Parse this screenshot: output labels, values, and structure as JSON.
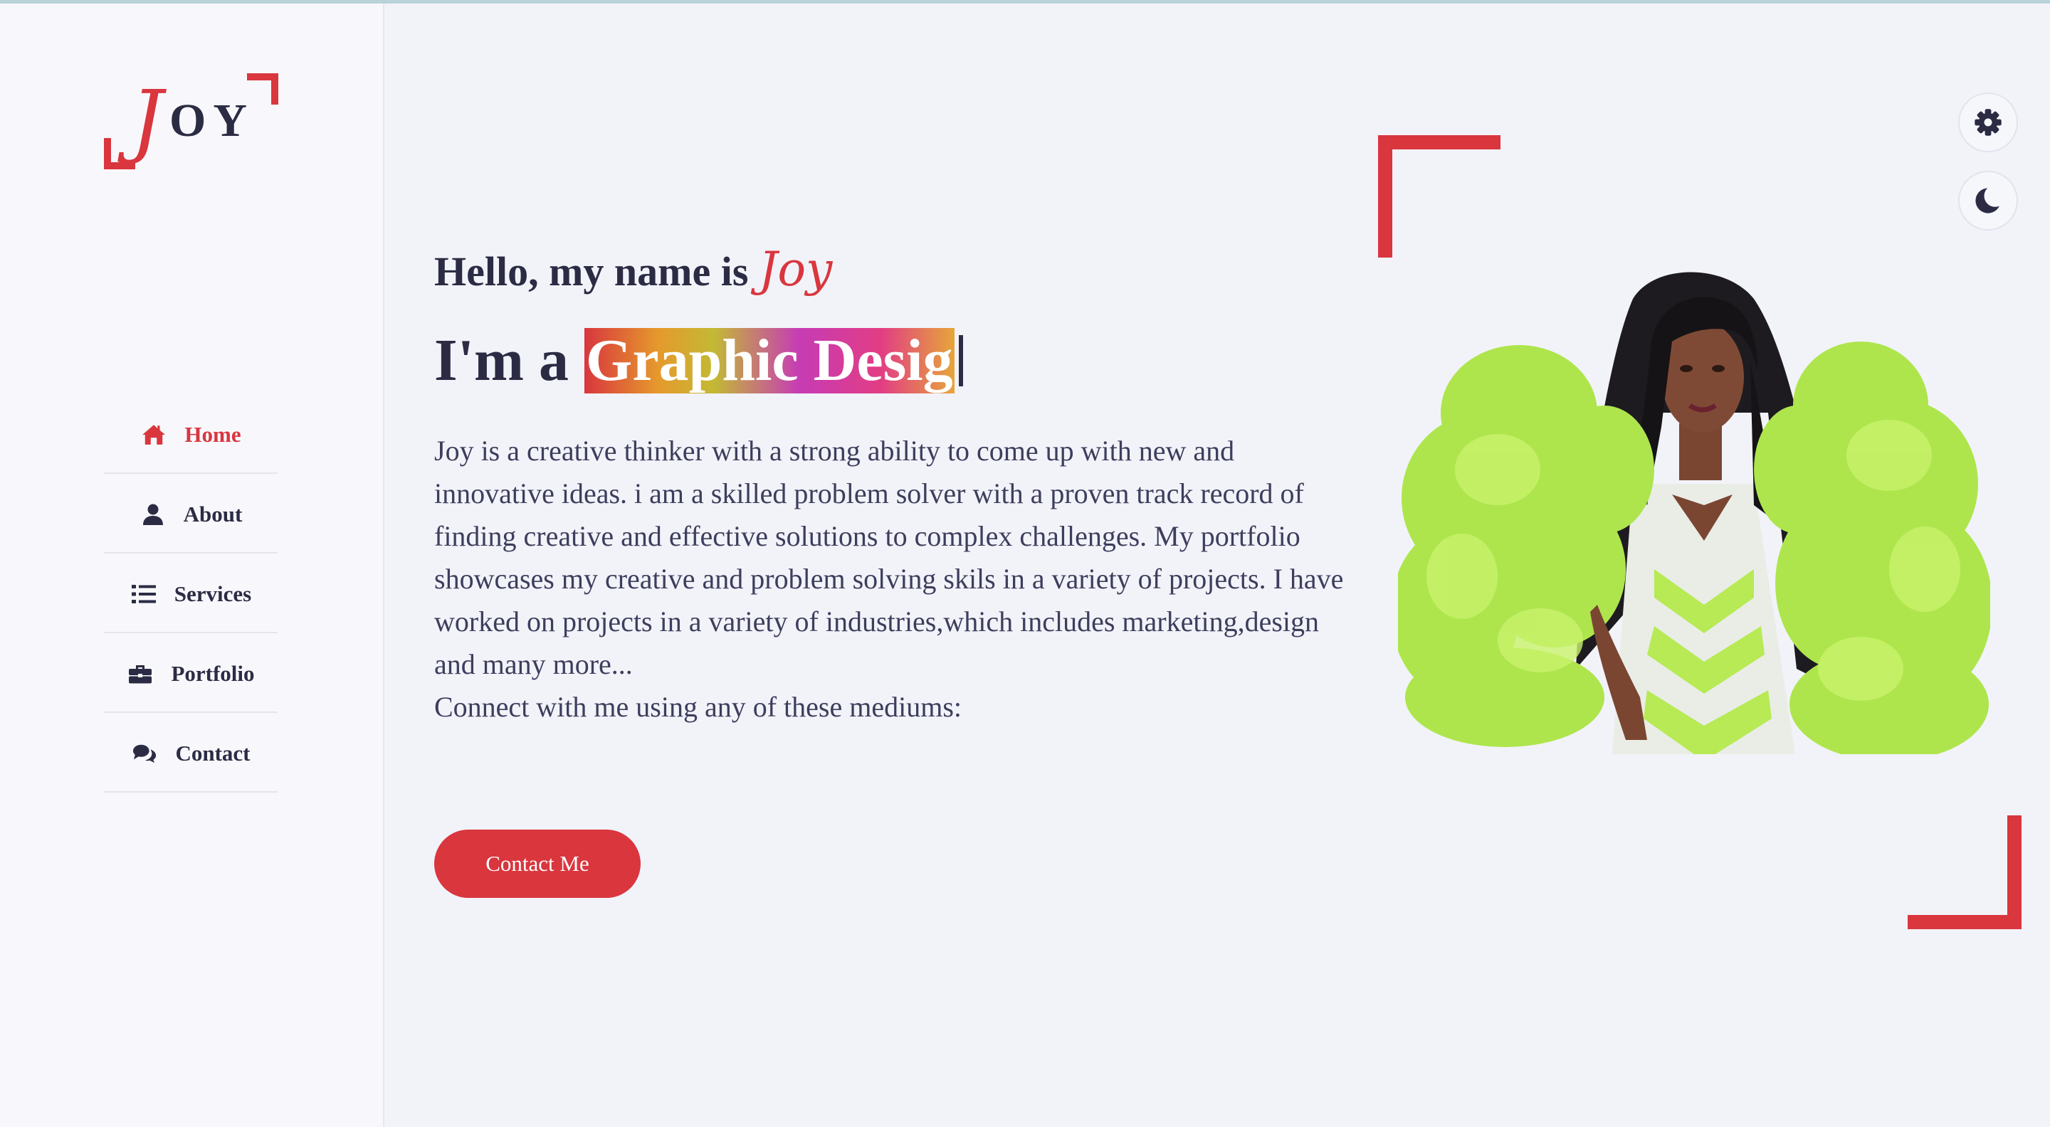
{
  "logo": {
    "j": "J",
    "rest": "OY"
  },
  "nav": [
    {
      "label": "Home",
      "icon": "home-icon",
      "active": true
    },
    {
      "label": "About",
      "icon": "user-icon"
    },
    {
      "label": "Services",
      "icon": "list-icon"
    },
    {
      "label": "Portfolio",
      "icon": "briefcase-icon"
    },
    {
      "label": "Contact",
      "icon": "comments-icon"
    }
  ],
  "hero": {
    "hello": "Hello, my name is",
    "name": "Joy",
    "role_prefix": "I'm a",
    "role_typed": "Graphic Desig",
    "description": "Joy is a creative thinker with a strong ability to come up with new and innovative ideas. i am a skilled problem solver with a proven track record of finding creative and effective solutions to complex challenges. My portfolio showcases my creative and problem solving skils in a variety of projects. I have worked on projects in a variety of industries,which includes marketing,design and many more...",
    "connect": "Connect with me using any of these mediums:",
    "button": "Contact Me"
  },
  "controls": {
    "settings_icon": "gear-icon",
    "theme_icon": "moon-icon"
  },
  "colors": {
    "accent": "#d9363e",
    "text": "#2b2c44",
    "background": "#f2f3f9"
  }
}
